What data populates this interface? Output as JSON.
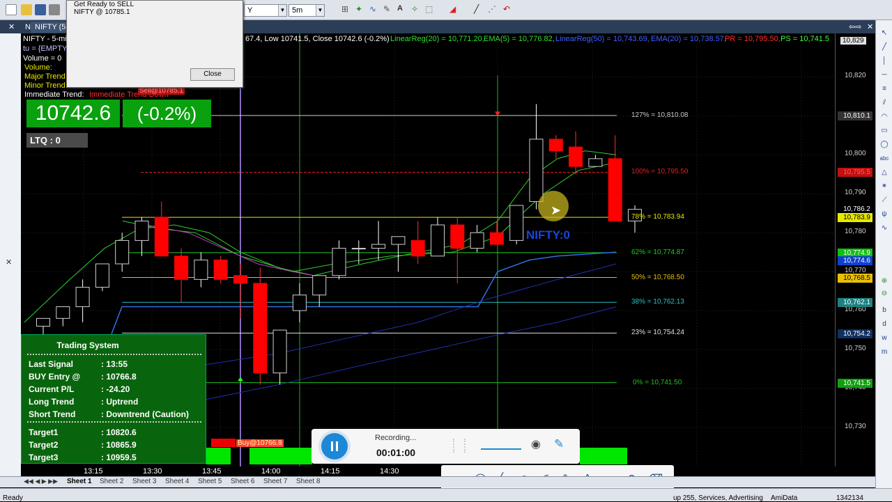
{
  "toolbar": {
    "interval_value": "5m",
    "symbol_select_value": "Y"
  },
  "tabs": {
    "tab1": "NIFTY (5-",
    "tab2": "NIFTY (5-"
  },
  "dialog": {
    "line1": "Get Ready to SELL",
    "line2": "NIFTY @ 10785.1",
    "close_label": "Close"
  },
  "chart_header": {
    "title_fragment": "NIFTY - 5-mi",
    "ohlc_text": "67.4, Low 10741.5, Close 10742.6 (-0.2%)",
    "linreg20": "LinearReg(20) = 10,771.20,",
    "ema5": "EMA(5) = 10,776.82,",
    "linreg50": "LinearReg(50) = 10,743.69,",
    "ema20": "EMA(20) = 10,738.57,",
    "pr": "PR = 10,795.50,",
    "ps": "PS = 10,741.5"
  },
  "top_left": {
    "tu": "tu = {EMPTY}",
    "volume0": "Volume = 0",
    "volume": "Volume:",
    "major": "Major Trend:",
    "minor": "Minor Trend:",
    "immediate": "Immediate Trend:",
    "immediate_value": "Immediate Trend Down",
    "sell_tag": "Sell@10785.1"
  },
  "price_box": {
    "price": "10742.6",
    "pct": "(-0.2%)",
    "ltq": "LTQ : 0"
  },
  "fib_levels": [
    {
      "label": "127% = 10,810.08",
      "color": "#c8c8c8"
    },
    {
      "label": "100% = 10,795.50",
      "color": "#e02020"
    },
    {
      "label": "78% = 10,783.94",
      "color": "#e8e800"
    },
    {
      "label": "62% = 10,774.87",
      "color": "#20d020"
    },
    {
      "label": "50% = 10,768.50",
      "color": "#e8c000"
    },
    {
      "label": "38% = 10,762.13",
      "color": "#30c0c0"
    },
    {
      "label": "23% = 10,754.24",
      "color": "#e0e0e0"
    },
    {
      "label": "0% = 10,741.50",
      "color": "#20c020"
    }
  ],
  "y_axis": {
    "ticks": [
      "10,829",
      "10,820",
      "10,810",
      "10,800",
      "10,790",
      "10,780",
      "10,770",
      "10,760",
      "10,750",
      "10,740",
      "10,730"
    ],
    "tags": [
      {
        "label": "10,810.1",
        "bg": "#333333",
        "color": "#ffffff"
      },
      {
        "label": "10,795.5",
        "bg": "#c01010",
        "color": "#ff6060"
      },
      {
        "label": "10,786.2",
        "bg": "#000000",
        "color": "#ffffff"
      },
      {
        "label": "10,783.9",
        "bg": "#e8e800",
        "color": "#000000"
      },
      {
        "label": "10,774.9",
        "bg": "#10c010",
        "color": "#ffffff"
      },
      {
        "label": "10,774.6",
        "bg": "#1040d0",
        "color": "#ffffff"
      },
      {
        "label": "10,768.5",
        "bg": "#e8c000",
        "color": "#000000"
      },
      {
        "label": "10,762.1",
        "bg": "#208080",
        "color": "#ffffff"
      },
      {
        "label": "10,754.2",
        "bg": "#103060",
        "color": "#ffffff"
      },
      {
        "label": "10,741.5",
        "bg": "#10a010",
        "color": "#ffffff"
      }
    ]
  },
  "x_axis": [
    "13:15",
    "13:30",
    "13:45",
    "14:00",
    "14:15",
    "14:30"
  ],
  "nifty_watermark": "NIFTY:0",
  "buy_marker": "Buy@10766.8",
  "trading_system": {
    "title": "Trading System",
    "rows": [
      {
        "k": "Last Signal",
        "v": ": 13:55"
      },
      {
        "k": "BUY Entry @",
        "v": ": 10766.8"
      },
      {
        "k": "Current P/L",
        "v": ": -24.20"
      },
      {
        "k": "Long Trend",
        "v": ": Uptrend"
      },
      {
        "k": "Short Trend",
        "v": ": Downtrend (Caution)"
      },
      {
        "k": "Target1",
        "v": ": 10820.6"
      },
      {
        "k": "Target2",
        "v": ": 10865.9"
      },
      {
        "k": "Target3",
        "v": ": 10959.5"
      }
    ]
  },
  "recording": {
    "label": "Recording...",
    "time": "00:01:00"
  },
  "sheets": [
    "Sheet 1",
    "Sheet 2",
    "Sheet 3",
    "Sheet 4",
    "Sheet 5",
    "Sheet 6",
    "Sheet 7",
    "Sheet 8"
  ],
  "status": {
    "ready": "Ready",
    "center": "up 255, Services, Advertising",
    "app": "AmiData",
    "num": "1342134"
  },
  "candles": [
    {
      "t": 0,
      "o": 10756,
      "h": 10758,
      "l": 10751,
      "c": 10758
    },
    {
      "t": 1,
      "o": 10758,
      "h": 10761,
      "l": 10756,
      "c": 10761
    },
    {
      "t": 2,
      "o": 10761,
      "h": 10768,
      "l": 10757,
      "c": 10766
    },
    {
      "t": 3,
      "o": 10766,
      "h": 10772,
      "l": 10765,
      "c": 10772
    },
    {
      "t": 4,
      "o": 10772,
      "h": 10780,
      "l": 10770,
      "c": 10778
    },
    {
      "t": 5,
      "o": 10778,
      "h": 10784,
      "l": 10774,
      "c": 10783
    },
    {
      "t": 6,
      "o": 10784,
      "h": 10788,
      "l": 10779,
      "c": 10774
    },
    {
      "t": 7,
      "o": 10774,
      "h": 10776,
      "l": 10762,
      "c": 10768
    },
    {
      "t": 8,
      "o": 10768,
      "h": 10775,
      "l": 10766,
      "c": 10773
    },
    {
      "t": 9,
      "o": 10773,
      "h": 10774,
      "l": 10767,
      "c": 10768
    },
    {
      "t": 10,
      "o": 10769,
      "h": 10772,
      "l": 10758,
      "c": 10767
    },
    {
      "t": 11,
      "o": 10767,
      "h": 10771,
      "l": 10741,
      "c": 10744
    },
    {
      "t": 12,
      "o": 10744,
      "h": 10755,
      "l": 10741,
      "c": 10755
    },
    {
      "t": 13,
      "o": 10760,
      "h": 10767,
      "l": 10757,
      "c": 10764
    },
    {
      "t": 14,
      "o": 10764,
      "h": 10769,
      "l": 10761,
      "c": 10769
    },
    {
      "t": 15,
      "o": 10769,
      "h": 10778,
      "l": 10768,
      "c": 10776
    },
    {
      "t": 16,
      "o": 10776,
      "h": 10778,
      "l": 10772,
      "c": 10776
    },
    {
      "t": 17,
      "o": 10776,
      "h": 10783,
      "l": 10773,
      "c": 10777
    },
    {
      "t": 18,
      "o": 10777,
      "h": 10779,
      "l": 10770,
      "c": 10779
    },
    {
      "t": 19,
      "o": 10778,
      "h": 10783,
      "l": 10772,
      "c": 10774
    },
    {
      "t": 20,
      "o": 10774,
      "h": 10784,
      "l": 10774,
      "c": 10782
    },
    {
      "t": 21,
      "o": 10782,
      "h": 10784,
      "l": 10767,
      "c": 10776
    },
    {
      "t": 22,
      "o": 10776,
      "h": 10782,
      "l": 10775,
      "c": 10780
    },
    {
      "t": 23,
      "o": 10780,
      "h": 10783,
      "l": 10777,
      "c": 10777
    },
    {
      "t": 24,
      "o": 10778,
      "h": 10787,
      "l": 10777,
      "c": 10787
    },
    {
      "t": 25,
      "o": 10788,
      "h": 10813,
      "l": 10786,
      "c": 10804
    },
    {
      "t": 26,
      "o": 10804,
      "h": 10805,
      "l": 10799,
      "c": 10801
    },
    {
      "t": 27,
      "o": 10802,
      "h": 10806,
      "l": 10795,
      "c": 10797
    },
    {
      "t": 28,
      "o": 10797,
      "h": 10800,
      "l": 10797,
      "c": 10799
    },
    {
      "t": 29,
      "o": 10799,
      "h": 10805,
      "l": 10783,
      "c": 10783
    },
    {
      "t": 30,
      "o": 10783,
      "h": 10787,
      "l": 10780,
      "c": 10786
    }
  ]
}
